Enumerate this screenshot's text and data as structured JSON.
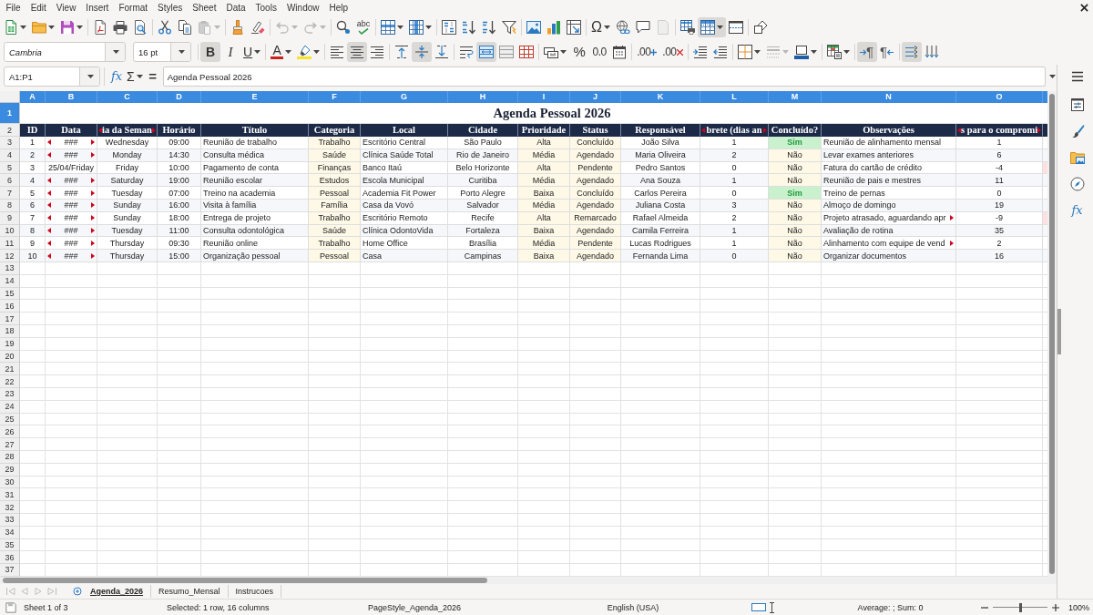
{
  "menu_bar": {
    "items": [
      "File",
      "Edit",
      "View",
      "Insert",
      "Format",
      "Styles",
      "Sheet",
      "Data",
      "Tools",
      "Window",
      "Help"
    ]
  },
  "standard_toolbar": {
    "groups": [
      [
        {
          "kind": "new",
          "menu": true,
          "active": false,
          "disabled": false
        },
        {
          "kind": "open",
          "menu": true,
          "active": false,
          "disabled": false
        },
        {
          "kind": "save",
          "menu": true,
          "active": false,
          "disabled": false
        }
      ],
      [
        {
          "kind": "pdf",
          "menu": false,
          "active": false,
          "disabled": false
        },
        {
          "kind": "print",
          "menu": false,
          "active": false,
          "disabled": false
        },
        {
          "kind": "preview",
          "menu": false,
          "active": false,
          "disabled": false
        }
      ],
      [
        {
          "kind": "cut",
          "menu": false,
          "active": false,
          "disabled": false
        },
        {
          "kind": "copy",
          "menu": false,
          "active": false,
          "disabled": false
        },
        {
          "kind": "paste",
          "menu": true,
          "active": false,
          "disabled": true
        }
      ],
      [
        {
          "kind": "clone",
          "menu": false,
          "active": false,
          "disabled": false
        },
        {
          "kind": "clear",
          "menu": false,
          "active": false,
          "disabled": false
        }
      ],
      [
        {
          "kind": "undo",
          "menu": true,
          "active": false,
          "disabled": true
        },
        {
          "kind": "redo",
          "menu": true,
          "active": false,
          "disabled": true
        }
      ],
      [
        {
          "kind": "find",
          "menu": false,
          "active": false,
          "disabled": false
        },
        {
          "kind": "spelling",
          "glyph": "abc",
          "menu": false,
          "active": false,
          "disabled": false
        }
      ],
      [
        {
          "kind": "rows",
          "menu": true,
          "active": false,
          "disabled": false
        },
        {
          "kind": "columns",
          "menu": true,
          "active": false,
          "disabled": false
        }
      ],
      [
        {
          "kind": "sort",
          "menu": false,
          "active": false,
          "disabled": false
        },
        {
          "kind": "sortasc",
          "menu": false,
          "active": false,
          "disabled": false
        },
        {
          "kind": "sortdesc",
          "menu": false,
          "active": false,
          "disabled": false
        },
        {
          "kind": "filter",
          "menu": false,
          "active": false,
          "disabled": false
        }
      ],
      [
        {
          "kind": "image",
          "menu": false,
          "active": false,
          "disabled": false
        },
        {
          "kind": "chart",
          "menu": false,
          "active": false,
          "disabled": false
        },
        {
          "kind": "pivot",
          "menu": false,
          "active": false,
          "disabled": false
        }
      ],
      [
        {
          "kind": "omega",
          "glyph": "Ω",
          "menu": true,
          "active": false,
          "disabled": false
        },
        {
          "kind": "link",
          "menu": false,
          "active": false,
          "disabled": false
        },
        {
          "kind": "comment",
          "menu": false,
          "active": false,
          "disabled": false
        },
        {
          "kind": "headerfooter",
          "menu": false,
          "active": false,
          "disabled": true
        }
      ],
      [
        {
          "kind": "printarea",
          "menu": false,
          "active": false,
          "disabled": false
        },
        {
          "kind": "freeze",
          "menu": true,
          "active": true,
          "disabled": false
        },
        {
          "kind": "split",
          "menu": false,
          "active": false,
          "disabled": false
        }
      ],
      [
        {
          "kind": "shapes",
          "menu": false,
          "active": false,
          "disabled": false
        }
      ]
    ]
  },
  "formatting_toolbar": {
    "font_name": "Cambria",
    "font_size": "16 pt",
    "groups": [
      [
        {
          "kind": "bold",
          "glyph": "B",
          "menu": false,
          "active": true,
          "disabled": false
        },
        {
          "kind": "italic",
          "glyph": "I",
          "menu": false,
          "active": false,
          "disabled": false
        },
        {
          "kind": "underline",
          "glyph": "U",
          "menu": true,
          "active": false,
          "disabled": false
        }
      ],
      [
        {
          "kind": "fontcolor",
          "glyph": "A",
          "menu": true,
          "active": false,
          "disabled": false
        },
        {
          "kind": "highlight",
          "menu": true,
          "active": false,
          "disabled": false
        }
      ],
      [
        {
          "kind": "alignleft",
          "menu": false,
          "active": false,
          "disabled": false
        },
        {
          "kind": "aligncenter",
          "menu": false,
          "active": true,
          "disabled": false
        },
        {
          "kind": "alignright",
          "menu": false,
          "active": false,
          "disabled": false
        }
      ],
      [
        {
          "kind": "aligntop",
          "menu": false,
          "active": false,
          "disabled": false
        },
        {
          "kind": "alignmiddle",
          "menu": false,
          "active": true,
          "disabled": false
        },
        {
          "kind": "alignbottom",
          "menu": false,
          "active": false,
          "disabled": false
        }
      ],
      [
        {
          "kind": "wrap",
          "menu": false,
          "active": false,
          "disabled": false
        },
        {
          "kind": "mergecenter",
          "menu": false,
          "active": true,
          "disabled": false
        },
        {
          "kind": "merge",
          "menu": false,
          "active": false,
          "disabled": false
        },
        {
          "kind": "unmerge",
          "menu": false,
          "active": false,
          "disabled": false
        }
      ],
      [
        {
          "kind": "numberformat",
          "menu": true,
          "active": false,
          "disabled": false
        },
        {
          "kind": "percent",
          "glyph": "%",
          "menu": false,
          "active": false,
          "disabled": false
        },
        {
          "kind": "number",
          "glyph": "0.0",
          "menu": false,
          "active": false,
          "disabled": false
        },
        {
          "kind": "date",
          "menu": false,
          "active": false,
          "disabled": false
        }
      ],
      [
        {
          "kind": "adddecimal",
          "glyph": ".00",
          "menu": false,
          "active": false,
          "disabled": false
        },
        {
          "kind": "deldecimal",
          "glyph": ".00",
          "menu": false,
          "active": false,
          "disabled": false
        }
      ],
      [
        {
          "kind": "indent",
          "menu": false,
          "active": false,
          "disabled": false
        },
        {
          "kind": "outdent",
          "menu": false,
          "active": false,
          "disabled": false
        }
      ],
      [
        {
          "kind": "borders",
          "menu": true,
          "active": false,
          "disabled": false
        },
        {
          "kind": "borderstyle",
          "menu": true,
          "active": false,
          "disabled": true
        },
        {
          "kind": "bordercolor",
          "menu": true,
          "active": false,
          "disabled": false
        }
      ],
      [
        {
          "kind": "conditional",
          "menu": true,
          "active": false,
          "disabled": false
        }
      ],
      [
        {
          "kind": "ltr",
          "glyph": "¶",
          "menu": false,
          "active": true,
          "disabled": false
        },
        {
          "kind": "rtl",
          "glyph": "¶",
          "menu": false,
          "active": false,
          "disabled": false
        }
      ],
      [
        {
          "kind": "textdir",
          "menu": false,
          "active": true,
          "disabled": false
        },
        {
          "kind": "vertical",
          "menu": false,
          "active": false,
          "disabled": false
        }
      ]
    ]
  },
  "formula_bar": {
    "name_box": "A1:P1",
    "buttons": [
      {
        "kind": "wizard",
        "glyph": "fx",
        "menu": false
      },
      {
        "kind": "sum",
        "glyph": "Σ",
        "menu": true
      },
      {
        "kind": "formula",
        "glyph": "=",
        "menu": false
      }
    ],
    "content": "Agenda Pessoal 2026"
  },
  "sheet": {
    "column_headers": [
      {
        "label": "A",
        "selected": true
      },
      {
        "label": "B",
        "selected": true
      },
      {
        "label": "C",
        "selected": true
      },
      {
        "label": "D",
        "selected": true
      },
      {
        "label": "E",
        "selected": true
      },
      {
        "label": "F",
        "selected": true
      },
      {
        "label": "G",
        "selected": true
      },
      {
        "label": "H",
        "selected": true
      },
      {
        "label": "I",
        "selected": true
      },
      {
        "label": "J",
        "selected": true
      },
      {
        "label": "K",
        "selected": true
      },
      {
        "label": "L",
        "selected": true
      },
      {
        "label": "M",
        "selected": true
      },
      {
        "label": "N",
        "selected": true
      },
      {
        "label": "O",
        "selected": true
      }
    ],
    "title_row": {
      "number": "1",
      "selected": true,
      "title": "Agenda Pessoal 2026"
    },
    "header_row": {
      "number": "2",
      "selected": false,
      "cells": [
        {
          "text": "ID",
          "clipped": false
        },
        {
          "text": "Data",
          "clipped": false
        },
        {
          "text": "ia da Seman",
          "clipped": true
        },
        {
          "text": "Horário",
          "clipped": false
        },
        {
          "text": "Título",
          "clipped": false
        },
        {
          "text": "Categoria",
          "clipped": false
        },
        {
          "text": "Local",
          "clipped": false
        },
        {
          "text": "Cidade",
          "clipped": false
        },
        {
          "text": "Prioridade",
          "clipped": false
        },
        {
          "text": "Status",
          "clipped": false
        },
        {
          "text": "Responsável",
          "clipped": false
        },
        {
          "text": "brete (dias an",
          "clipped": true
        },
        {
          "text": "Concluído?",
          "clipped": false
        },
        {
          "text": "Observações",
          "clipped": false
        },
        {
          "text": "s para o compromi",
          "clipped": true
        }
      ]
    },
    "rows": [
      {
        "number": "3",
        "selected": false,
        "cells": [
          "1",
          "###",
          "Wednesday",
          "09:00",
          "Reunião de trabalho",
          "Trabalho",
          "Escritório Central",
          "São Paulo",
          "Alta",
          "Concluído",
          "João Silva",
          "1",
          "Sim",
          "Reunião de alinhamento mensal",
          "1"
        ],
        "date_clipped": true,
        "note_clipped": false,
        "done": true,
        "flagged": false
      },
      {
        "number": "4",
        "selected": false,
        "cells": [
          "2",
          "###",
          "Monday",
          "14:30",
          "Consulta médica",
          "Saúde",
          "Clínica Saúde Total",
          "Rio de Janeiro",
          "Média",
          "Agendado",
          "Maria Oliveira",
          "2",
          "Não",
          "Levar exames anteriores",
          "6"
        ],
        "date_clipped": true,
        "note_clipped": false,
        "done": false,
        "flagged": false
      },
      {
        "number": "5",
        "selected": false,
        "cells": [
          "3",
          "25/04/Friday",
          "Friday",
          "10:00",
          "Pagamento de conta",
          "Finanças",
          "Banco Itaú",
          "Belo Horizonte",
          "Alta",
          "Pendente",
          "Pedro Santos",
          "0",
          "Não",
          "Fatura do cartão de crédito",
          "-4"
        ],
        "date_clipped": false,
        "note_clipped": false,
        "done": false,
        "flagged": true
      },
      {
        "number": "6",
        "selected": false,
        "cells": [
          "4",
          "###",
          "Saturday",
          "19:00",
          "Reunião escolar",
          "Estudos",
          "Escola Municipal",
          "Curitiba",
          "Média",
          "Agendado",
          "Ana Souza",
          "1",
          "Não",
          "Reunião de pais e mestres",
          "11"
        ],
        "date_clipped": true,
        "note_clipped": false,
        "done": false,
        "flagged": false
      },
      {
        "number": "7",
        "selected": false,
        "cells": [
          "5",
          "###",
          "Tuesday",
          "07:00",
          "Treino na academia",
          "Pessoal",
          "Academia Fit Power",
          "Porto Alegre",
          "Baixa",
          "Concluído",
          "Carlos Pereira",
          "0",
          "Sim",
          "Treino de pernas",
          "0"
        ],
        "date_clipped": true,
        "note_clipped": false,
        "done": true,
        "flagged": false
      },
      {
        "number": "8",
        "selected": false,
        "cells": [
          "6",
          "###",
          "Sunday",
          "16:00",
          "Visita à família",
          "Família",
          "Casa da Vovó",
          "Salvador",
          "Média",
          "Agendado",
          "Juliana Costa",
          "3",
          "Não",
          "Almoço de domingo",
          "19"
        ],
        "date_clipped": true,
        "note_clipped": false,
        "done": false,
        "flagged": false
      },
      {
        "number": "9",
        "selected": false,
        "cells": [
          "7",
          "###",
          "Sunday",
          "18:00",
          "Entrega de projeto",
          "Trabalho",
          "Escritório Remoto",
          "Recife",
          "Alta",
          "Remarcado",
          "Rafael Almeida",
          "2",
          "Não",
          "Projeto atrasado, aguardando apr",
          "-9"
        ],
        "date_clipped": true,
        "note_clipped": true,
        "done": false,
        "flagged": true
      },
      {
        "number": "10",
        "selected": false,
        "cells": [
          "8",
          "###",
          "Tuesday",
          "11:00",
          "Consulta odontológica",
          "Saúde",
          "Clínica OdontoVida",
          "Fortaleza",
          "Baixa",
          "Agendado",
          "Camila Ferreira",
          "1",
          "Não",
          "Avaliação de rotina",
          "35"
        ],
        "date_clipped": true,
        "note_clipped": false,
        "done": false,
        "flagged": false
      },
      {
        "number": "11",
        "selected": false,
        "cells": [
          "9",
          "###",
          "Thursday",
          "09:30",
          "Reunião online",
          "Trabalho",
          "Home Office",
          "Brasília",
          "Média",
          "Pendente",
          "Lucas Rodrigues",
          "1",
          "Não",
          "Alinhamento com equipe de vend",
          "2"
        ],
        "date_clipped": true,
        "note_clipped": true,
        "done": false,
        "flagged": false
      },
      {
        "number": "12",
        "selected": false,
        "cells": [
          "10",
          "###",
          "Thursday",
          "15:00",
          "Organização pessoal",
          "Pessoal",
          "Casa",
          "Campinas",
          "Baixa",
          "Agendado",
          "Fernanda Lima",
          "0",
          "Não",
          "Organizar documentos",
          "16"
        ],
        "date_clipped": true,
        "note_clipped": false,
        "done": false,
        "flagged": false
      }
    ],
    "empty_rows": [
      {
        "number": "13",
        "selected": false
      },
      {
        "number": "14",
        "selected": false
      },
      {
        "number": "15",
        "selected": false
      },
      {
        "number": "16",
        "selected": false
      },
      {
        "number": "17",
        "selected": false
      },
      {
        "number": "18",
        "selected": false
      },
      {
        "number": "19",
        "selected": false
      },
      {
        "number": "20",
        "selected": false
      },
      {
        "number": "21",
        "selected": false
      },
      {
        "number": "22",
        "selected": false
      },
      {
        "number": "23",
        "selected": false
      },
      {
        "number": "24",
        "selected": false
      },
      {
        "number": "25",
        "selected": false
      },
      {
        "number": "26",
        "selected": false
      },
      {
        "number": "27",
        "selected": false
      },
      {
        "number": "28",
        "selected": false
      },
      {
        "number": "29",
        "selected": false
      },
      {
        "number": "30",
        "selected": false
      },
      {
        "number": "31",
        "selected": false
      },
      {
        "number": "32",
        "selected": false
      },
      {
        "number": "33",
        "selected": false
      },
      {
        "number": "34",
        "selected": false
      },
      {
        "number": "35",
        "selected": false
      },
      {
        "number": "36",
        "selected": false
      },
      {
        "number": "37",
        "selected": false
      }
    ]
  },
  "sidebar": {
    "buttons": [
      {
        "kind": "menu"
      },
      {
        "kind": "properties"
      },
      {
        "kind": "styles"
      },
      {
        "kind": "gallery"
      },
      {
        "kind": "navigator"
      },
      {
        "kind": "functions",
        "glyph": "fx"
      }
    ]
  },
  "tab_navigation": [
    {
      "kind": "first",
      "disabled": true
    },
    {
      "kind": "previous",
      "disabled": true
    },
    {
      "kind": "next",
      "disabled": true
    },
    {
      "kind": "last",
      "disabled": true
    },
    {
      "kind": "add",
      "disabled": false
    }
  ],
  "sheet_tabs": [
    {
      "label": "Agenda_2026",
      "selected": true
    },
    {
      "label": "Resumo_Mensal",
      "selected": false
    },
    {
      "label": "Instrucoes",
      "selected": false
    }
  ],
  "status_bar": {
    "sheet_count": "Sheet 1 of 3",
    "selection": "Selected: 1 row, 16 columns",
    "page_style": "PageStyle_Agenda_2026",
    "language": "English (USA)",
    "summary": "Average: ; Sum: 0",
    "zoom": {
      "level": 0.5,
      "reading": "100%"
    }
  }
}
